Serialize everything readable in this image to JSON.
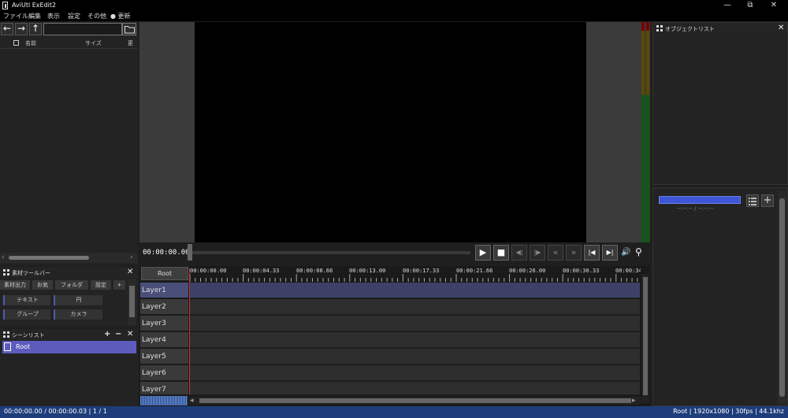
{
  "window": {
    "title": "AviUtl ExEdit2",
    "minimize": "—",
    "maximize": "⧉",
    "close": "✕"
  },
  "menu": [
    "ファイル",
    "編集",
    "表示",
    "設定",
    "その他",
    "● 更新"
  ],
  "file_browser": {
    "back": "←",
    "forward": "→",
    "up": "↑",
    "path_value": "",
    "columns": [
      "名前",
      "サイズ",
      "更"
    ]
  },
  "material_panel": {
    "title": "素材ツールバー",
    "tabs": [
      "素材出力",
      "お気",
      "フォルダ",
      "設定",
      "+"
    ],
    "items": [
      "テキスト",
      "円",
      "グループ",
      "カメラ"
    ]
  },
  "scene_panel": {
    "title": "シーンリスト",
    "add": "+",
    "remove": "−",
    "close": "✕",
    "scenes": [
      "Root"
    ]
  },
  "object_panel": {
    "title": "オブジェクトリスト"
  },
  "property_panel": {
    "time_text": "--:--:-- / --:--:--",
    "add": "+"
  },
  "transport": {
    "current_time": "00:00:00.00",
    "buttons": [
      "▶",
      "■",
      "◀|",
      "|▶",
      "«",
      "»",
      "|◀",
      "▶|",
      "🔊",
      "⚲"
    ]
  },
  "timeline": {
    "root_label": "Root",
    "ruler_labels": [
      "00:00:00.00",
      "00:00:04.33",
      "00:00:08.66",
      "00:00:13.00",
      "00:00:17.33",
      "00:00:21.66",
      "00:00:26.00",
      "00:00:30.33",
      "00:00:34"
    ],
    "layers": [
      "Layer1",
      "Layer2",
      "Layer3",
      "Layer4",
      "Layer5",
      "Layer6",
      "Layer7"
    ]
  },
  "status": {
    "left": "00:00:00.00 / 00:00:00.03  |  1 / 1",
    "right": "Root  |  1920x1080  |  30fps  |  44.1khz"
  },
  "colors": {
    "selection": "#5d5cbd",
    "status_bar": "#1e3d7a",
    "cursor": "#cc3333"
  }
}
